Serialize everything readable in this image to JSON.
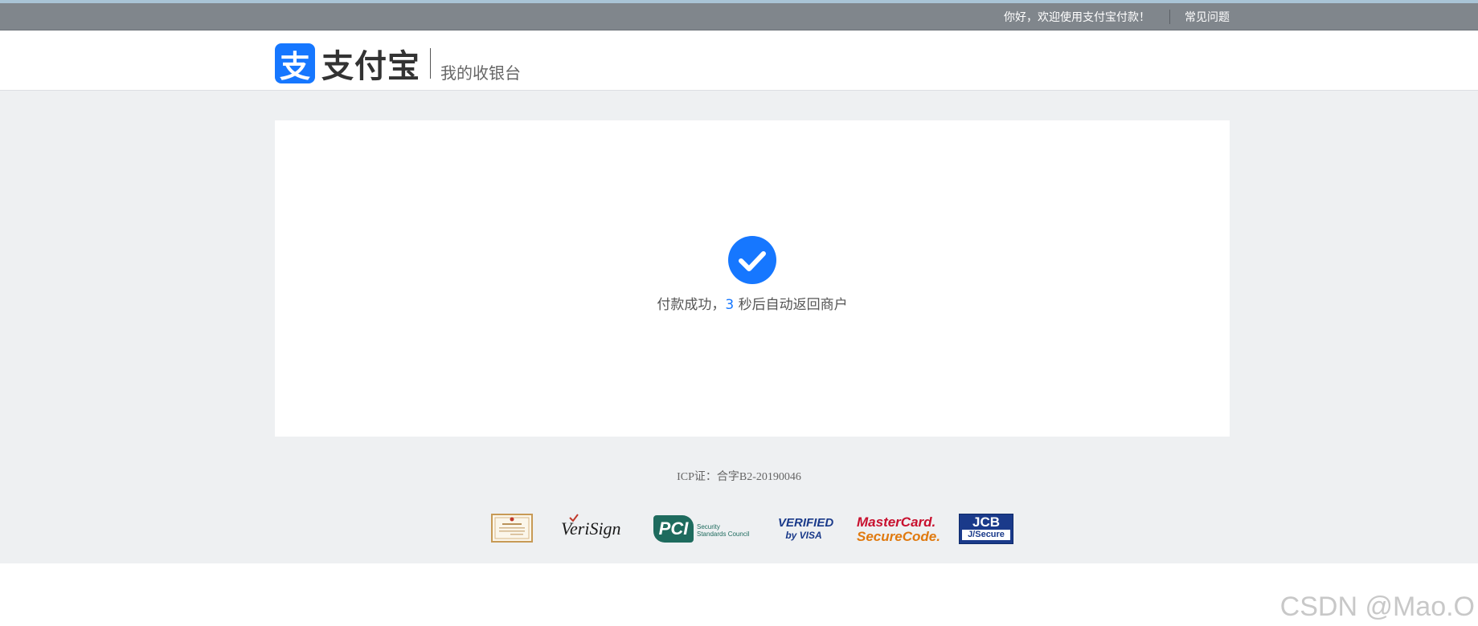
{
  "topbar": {
    "greeting": "你好，欢迎使用支付宝付款！",
    "faq": "常见问题"
  },
  "header": {
    "logo_glyph": "支",
    "logo_text": "支付宝",
    "subtitle": "我的收银台"
  },
  "result": {
    "icon": "check-circle-icon",
    "message_prefix": "付款成功，",
    "countdown": "3",
    "message_suffix": " 秒后自动返回商户"
  },
  "footer": {
    "icp": "ICP证：合字B2-20190046",
    "badges": [
      {
        "name": "business-license-badge"
      },
      {
        "name": "verisign-badge",
        "text": "VeriSign"
      },
      {
        "name": "pci-badge",
        "text": "PCI",
        "sub": "Security Standards Council"
      },
      {
        "name": "verified-by-visa-badge",
        "line1": "VERIFIED",
        "line2": "by VISA"
      },
      {
        "name": "mastercard-securecode-badge",
        "line1": "MasterCard.",
        "line2": "SecureCode."
      },
      {
        "name": "jcb-jsecure-badge",
        "line1": "JCB",
        "line2": "J/Secure"
      }
    ]
  },
  "watermark": "CSDN @Mao.O",
  "colors": {
    "brand": "#1677ff",
    "topbar": "#80868c",
    "background": "#eef0f2"
  }
}
